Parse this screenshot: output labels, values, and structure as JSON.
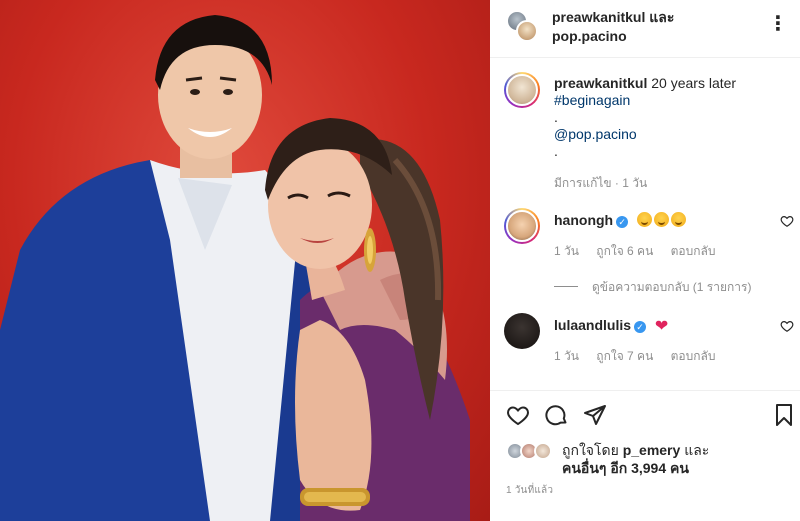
{
  "header": {
    "user1": "preawkanitkul",
    "and_text": "และ",
    "user2": "pop.pacino",
    "more_icon": "more-horizontal-icon"
  },
  "caption": {
    "username": "preawkanitkul",
    "text": "20 years later",
    "hashtag": "#beginagain",
    "dot1": ".",
    "mention": "@pop.pacino",
    "dot2": ".",
    "meta": "มีการแก้ไข · 1 วัน"
  },
  "comments": [
    {
      "username": "hanongh",
      "verified": true,
      "meta_time": "1 วัน",
      "meta_likes": "ถูกใจ 6 คน",
      "meta_reply": "ตอบกลับ",
      "view_replies": "ดูข้อความตอบกลับ (1 รายการ)"
    },
    {
      "username": "lulaandlulis",
      "verified": true,
      "meta_time": "1 วัน",
      "meta_likes": "ถูกใจ 7 คน",
      "meta_reply": "ตอบกลับ"
    }
  ],
  "actions": {
    "like_icon": "heart-icon",
    "comment_icon": "comment-icon",
    "share_icon": "send-icon",
    "save_icon": "bookmark-icon"
  },
  "likes": {
    "prefix": "ถูกใจโดย",
    "user": "p_emery",
    "and_text": "และ",
    "others": "คนอื่นๆ อีก 3,994 คน"
  },
  "timestamp": "1 วันที่แล้ว",
  "colors": {
    "link": "#00376b",
    "verified": "#3897f0",
    "secondary_text": "#8e8e8e",
    "photo_background": "#c8281f"
  }
}
